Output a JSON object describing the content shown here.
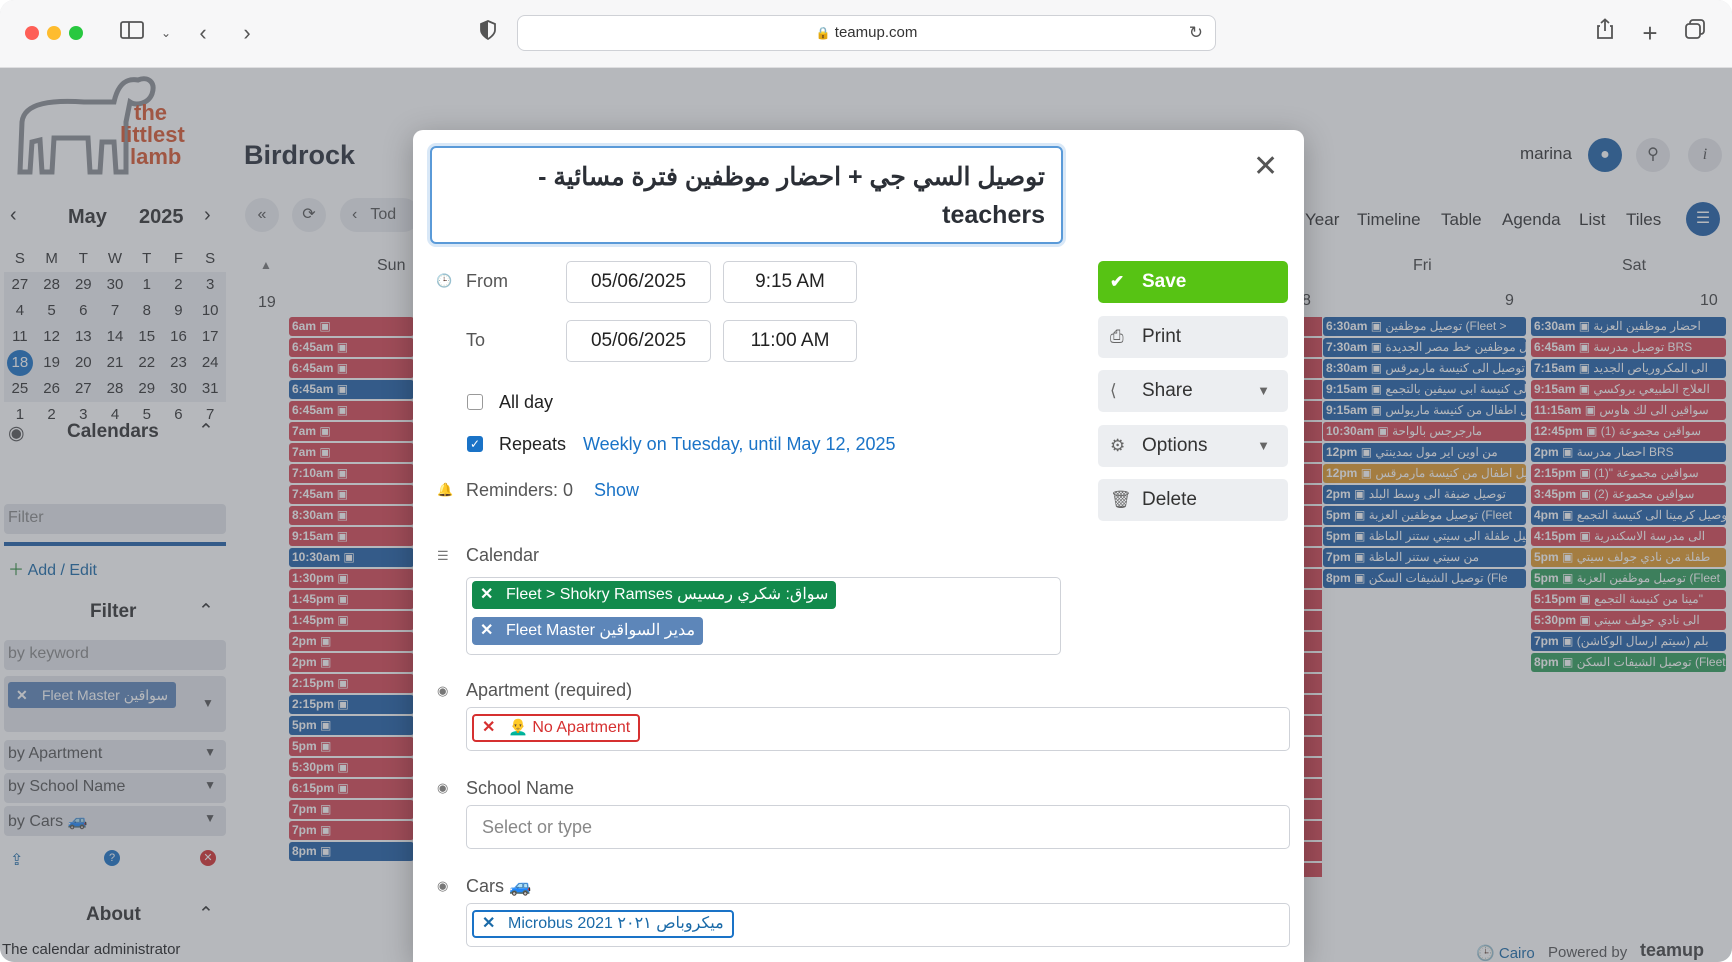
{
  "browser": {
    "url": "teamup.com"
  },
  "app": {
    "calendar_name": "Birdrock",
    "user": "marina",
    "logo": "the littlest lamb",
    "mini_calendar": {
      "month": "May",
      "year": "2025",
      "weekdays": [
        "S",
        "M",
        "T",
        "W",
        "T",
        "F",
        "S"
      ],
      "weeks": [
        [
          "27",
          "28",
          "29",
          "30",
          "1",
          "2",
          "3"
        ],
        [
          "4",
          "5",
          "6",
          "7",
          "8",
          "9",
          "10"
        ],
        [
          "11",
          "12",
          "13",
          "14",
          "15",
          "16",
          "17"
        ],
        [
          "18",
          "19",
          "20",
          "21",
          "22",
          "23",
          "24"
        ],
        [
          "25",
          "26",
          "27",
          "28",
          "29",
          "30",
          "31"
        ],
        [
          "1",
          "2",
          "3",
          "4",
          "5",
          "6",
          "7"
        ]
      ],
      "today": "18"
    },
    "sidebar": {
      "calendars_label": "Calendars",
      "filter_placeholder": "Filter",
      "add_edit": "Add / Edit",
      "filter_label": "Filter",
      "keyword_placeholder": "by keyword",
      "fleet_chip": "Fleet Master سواقين",
      "by_apartment": "by Apartment",
      "by_school": "by School Name",
      "by_cars": "by Cars 🚙",
      "about_label": "About",
      "about_text": "The calendar administrator"
    },
    "toolbar": {
      "today": "Tod",
      "views": [
        "Year",
        "Timeline",
        "Table",
        "Agenda",
        "List",
        "Tiles"
      ]
    },
    "columns": {
      "sun": "Sun",
      "sun_num": "19",
      "fri": "Fri",
      "fri_num": "9",
      "sat": "Sat",
      "sat_num": "10",
      "week_num_partial": "8"
    },
    "sun_events": [
      {
        "time": "6am",
        "color": "#d64553"
      },
      {
        "time": "6:45am",
        "color": "#d64553"
      },
      {
        "time": "6:45am",
        "color": "#d64553"
      },
      {
        "time": "6:45am",
        "color": "#1f5fa8"
      },
      {
        "time": "6:45am",
        "color": "#d64553"
      },
      {
        "time": "7am",
        "color": "#d64553"
      },
      {
        "time": "7am",
        "color": "#d64553"
      },
      {
        "time": "7:10am",
        "color": "#d64553"
      },
      {
        "time": "7:45am",
        "color": "#d64553"
      },
      {
        "time": "8:30am",
        "color": "#d64553"
      },
      {
        "time": "9:15am",
        "color": "#d64553"
      },
      {
        "time": "10:30am",
        "color": "#1f5fa8"
      },
      {
        "time": "1:30pm",
        "color": "#d64553"
      },
      {
        "time": "1:45pm",
        "color": "#d64553"
      },
      {
        "time": "1:45pm",
        "color": "#d64553"
      },
      {
        "time": "2pm",
        "color": "#d64553"
      },
      {
        "time": "2pm",
        "color": "#d64553"
      },
      {
        "time": "2:15pm",
        "color": "#d64553"
      },
      {
        "time": "2:15pm",
        "color": "#1f5fa8"
      },
      {
        "time": "5pm",
        "color": "#1f5fa8"
      },
      {
        "time": "5pm",
        "color": "#d64553"
      },
      {
        "time": "5:30pm",
        "color": "#d64553"
      },
      {
        "time": "6:15pm",
        "color": "#d64553"
      },
      {
        "time": "7pm",
        "color": "#d64553"
      },
      {
        "time": "7pm",
        "color": "#d64553"
      },
      {
        "time": "8pm",
        "color": "#1f5fa8"
      }
    ],
    "fri_events": [
      {
        "time": "6:30am",
        "text": "توصيل موظفين (Fleet >",
        "color": "#1f5fa8"
      },
      {
        "time": "7:30am",
        "text": "توصيل موظفين خط مصر الجديدة",
        "color": "#1f5fa8"
      },
      {
        "time": "8:30am",
        "text": "توصيل الى كنيسة مارمرقس",
        "color": "#1f5fa8"
      },
      {
        "time": "9:15am",
        "text": "توصيل الى كنيسة ابى سيفين بالتجمع",
        "color": "#1f5fa8"
      },
      {
        "time": "9:15am",
        "text": "توصيل اطفال من كنيسة ماريولس",
        "color": "#1f5fa8"
      },
      {
        "time": "10:30am",
        "text": "مارجرجس بالواحة",
        "color": "#d64553"
      },
      {
        "time": "12pm",
        "text": "من اوين اير مول بمدينتي",
        "color": "#1f5fa8"
      },
      {
        "time": "12pm",
        "text": "توصيل اطفال من كنيسة مارمرقس",
        "color": "#e09a2b"
      },
      {
        "time": "2pm",
        "text": "توصيل ضيفة الى وسط البلد",
        "color": "#1f5fa8"
      },
      {
        "time": "5pm",
        "text": "توصيل موظفين العزبة (Fleet",
        "color": "#1f5fa8"
      },
      {
        "time": "5pm",
        "text": "توصيل طفلة الى سيتي ستنر الماظة",
        "color": "#1f5fa8"
      },
      {
        "time": "7pm",
        "text": "من سيتي ستنر الماظة",
        "color": "#1f5fa8"
      },
      {
        "time": "8pm",
        "text": "توصيل الشيفات السكن (Fle",
        "color": "#1f5fa8"
      }
    ],
    "sat_events": [
      {
        "time": "6:30am",
        "text": "احضار موظفين العزبة",
        "color": "#1f5fa8"
      },
      {
        "time": "6:45am",
        "text": "توصيل مدرسة BRS",
        "color": "#d64553"
      },
      {
        "time": "7:15am",
        "text": "الى المكرورياص الجديد",
        "color": "#1f5fa8"
      },
      {
        "time": "9:15am",
        "text": "العلاج الطبيعي بروكسي",
        "color": "#d64553"
      },
      {
        "time": "11:15am",
        "text": "سواقين الى لك هاوس",
        "color": "#d64553"
      },
      {
        "time": "12:45pm",
        "text": "سواقين مجموعة (1)",
        "color": "#d64553"
      },
      {
        "time": "2pm",
        "text": "احضار مدرسة BRS",
        "color": "#1f5fa8"
      },
      {
        "time": "2:15pm",
        "text": "سواقين مجموعة \"(1)",
        "color": "#d64553"
      },
      {
        "time": "3:45pm",
        "text": "سواقين مجموعة (2)",
        "color": "#d64553"
      },
      {
        "time": "4pm",
        "text": "توصيل كرمينا الى كنيسة التجمع",
        "color": "#1f5fa8"
      },
      {
        "time": "4:15pm",
        "text": "الى مدرسة الاسكندرية",
        "color": "#d64553"
      },
      {
        "time": "5pm",
        "text": "طفلة من نادي جولف سيتي",
        "color": "#e09a2b"
      },
      {
        "time": "5pm",
        "text": "توصيل موظفين العزبة (Fleet",
        "color": "#2f9e5a"
      },
      {
        "time": "5:15pm",
        "text": "مينا من كنيسة التجمع\"",
        "color": "#d64553"
      },
      {
        "time": "5:30pm",
        "text": "الى نادي جولف سيتي",
        "color": "#d64553"
      },
      {
        "time": "7pm",
        "text": "(سيتم ارسال الوكاشن) بلم",
        "color": "#1f5fa8"
      },
      {
        "time": "8pm",
        "text": "توصيل الشيفات السكن (Fleet",
        "color": "#2f9e5a"
      }
    ],
    "footer": {
      "timezone": "Cairo",
      "powered": "Powered by",
      "brand": "teamup"
    }
  },
  "modal": {
    "title": "توصيل السي جي + احضار موظفين فترة مسائية - teachers",
    "from_label": "From",
    "from_date": "05/06/2025",
    "from_time": "9:15 AM",
    "to_label": "To",
    "to_date": "05/06/2025",
    "to_time": "11:00 AM",
    "all_day_label": "All day",
    "repeats_label": "Repeats",
    "repeats_value": "Weekly on Tuesday, until May 12, 2025",
    "reminders_label": "Reminders: 0",
    "reminders_show": "Show",
    "calendar_label": "Calendar",
    "calendar_tags": [
      {
        "text": "Fleet > Shokry Ramses سواق: شكري رمسيس",
        "color": "#128a4c"
      },
      {
        "text": "Fleet Master مدير السواقين",
        "color": "#5d86b9"
      }
    ],
    "apartment_label": "Apartment (required)",
    "apartment_value": "👨‍🦲 No Apartment",
    "school_label": "School Name",
    "school_placeholder": "Select or type",
    "cars_label": "Cars 🚙",
    "cars_value": "Microbus 2021 ميكروباص ٢٠٢١",
    "actions": {
      "save": "Save",
      "print": "Print",
      "share": "Share",
      "options": "Options",
      "delete": "Delete"
    }
  }
}
